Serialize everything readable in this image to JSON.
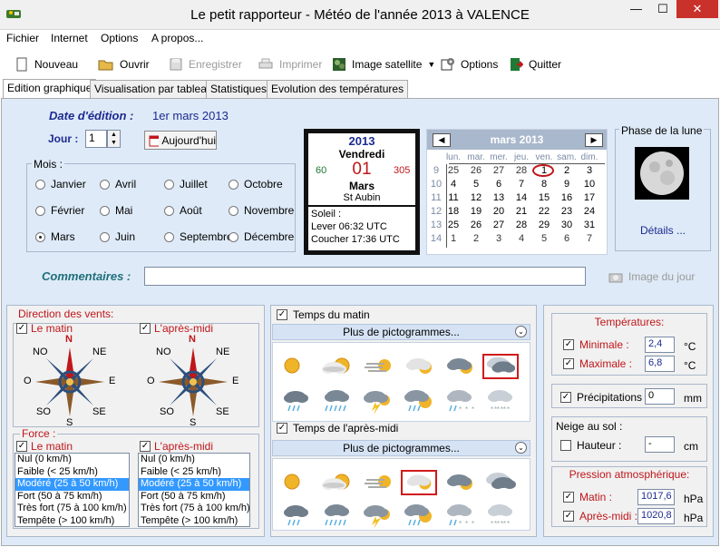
{
  "window": {
    "title": "Le petit rapporteur - Météo de l'année 2013 à VALENCE",
    "minimize": "—",
    "maximize": "☐",
    "close": "✕"
  },
  "menu": [
    "Fichier",
    "Internet",
    "Options",
    "A propos..."
  ],
  "toolbar": {
    "new": "Nouveau",
    "open": "Ouvrir",
    "save": "Enregistrer",
    "print": "Imprimer",
    "satellite": "Image satellite",
    "options": "Options",
    "quit": "Quitter"
  },
  "tabs": [
    "Edition graphique",
    "Visualisation par tableau",
    "Statistiques",
    "Evolution des températures"
  ],
  "edit": {
    "date_label": "Date d'édition :",
    "date_value": "1er mars 2013",
    "day_label": "Jour :",
    "day_value": "1",
    "today_button": "Aujourd'hui"
  },
  "months": {
    "title": "Mois :",
    "items": [
      "Janvier",
      "Avril",
      "Juillet",
      "Octobre",
      "Février",
      "Mai",
      "Août",
      "Novembre",
      "Mars",
      "Juin",
      "Septembre",
      "Décembre"
    ],
    "selected": "Mars"
  },
  "daycard": {
    "year": "2013",
    "weekday": "Vendredi",
    "day": "01",
    "month": "Mars",
    "left_num": "60",
    "right_num": "305",
    "saint": "St Aubin",
    "sun_label": "Soleil :",
    "sunrise": "Lever 06:32 UTC",
    "sunset": "Coucher 17:36 UTC"
  },
  "calendar": {
    "title": "mars 2013",
    "weekdays": [
      "lun.",
      "mar.",
      "mer.",
      "jeu.",
      "ven.",
      "sam.",
      "dim."
    ],
    "weeks": [
      "9",
      "10",
      "11",
      "12",
      "13",
      "14"
    ],
    "rows": [
      [
        "25",
        "26",
        "27",
        "28",
        "1",
        "2",
        "3"
      ],
      [
        "4",
        "5",
        "6",
        "7",
        "8",
        "9",
        "10"
      ],
      [
        "11",
        "12",
        "13",
        "14",
        "15",
        "16",
        "17"
      ],
      [
        "18",
        "19",
        "20",
        "21",
        "22",
        "23",
        "24"
      ],
      [
        "25",
        "26",
        "27",
        "28",
        "29",
        "30",
        "31"
      ],
      [
        "1",
        "2",
        "3",
        "4",
        "5",
        "6",
        "7"
      ]
    ]
  },
  "moon": {
    "title": "Phase de la lune",
    "details": "Détails ..."
  },
  "comments": {
    "label": "Commentaires :",
    "value": "",
    "image_button": "Image du jour"
  },
  "wind": {
    "title": "Direction des vents:",
    "morning": "Le matin",
    "afternoon": "L'après-midi",
    "compass": {
      "n": "N",
      "ne": "NE",
      "e": "E",
      "se": "SE",
      "s": "S",
      "so": "SO",
      "o": "O",
      "no": "NO"
    },
    "force_title": "Force :",
    "force_items": [
      "Nul (0 km/h)",
      "Faible (< 25 km/h)",
      "Modéré (25 à 50 km/h)",
      "Fort (50 à 75 km/h)",
      "Très fort (75 à 100 km/h)",
      "Tempête (> 100 km/h)"
    ],
    "force_selected_index": 2
  },
  "weather": {
    "morning_title": "Temps du matin",
    "afternoon_title": "Temps de l'après-midi",
    "more": "Plus de pictogrammes...",
    "icons": [
      "sun-icon",
      "sun-cloud-icon",
      "fog-sun-icon",
      "cloud-sun-icon",
      "dark-cloud-sun-icon",
      "overcast-icon",
      "rain-icon",
      "heavy-rain-icon",
      "storm-icon",
      "rain-sun-icon",
      "snow-rain-icon",
      "snow-icon"
    ],
    "morning_selected": 5,
    "afternoon_selected": 3
  },
  "temps": {
    "title": "Températures:",
    "min_label": "Minimale :",
    "min_value": "2,4",
    "max_label": "Maximale :",
    "max_value": "6,8",
    "unit": "°C"
  },
  "precip": {
    "label": "Précipitations :",
    "value": "0",
    "unit": "mm"
  },
  "snow": {
    "title": "Neige au sol :",
    "label": "Hauteur :",
    "value": "-",
    "unit": "cm"
  },
  "pressure": {
    "title": "Pression atmosphérique:",
    "morning_label": "Matin :",
    "morning_value": "1017,6",
    "afternoon_label": "Après-midi :",
    "afternoon_value": "1020,8",
    "unit": "hPa"
  },
  "colors": {
    "accent_red": "#c0161a",
    "title_blue": "#1c2a8f",
    "panel_bg": "#deeaf7",
    "selection": "#3399ff"
  }
}
